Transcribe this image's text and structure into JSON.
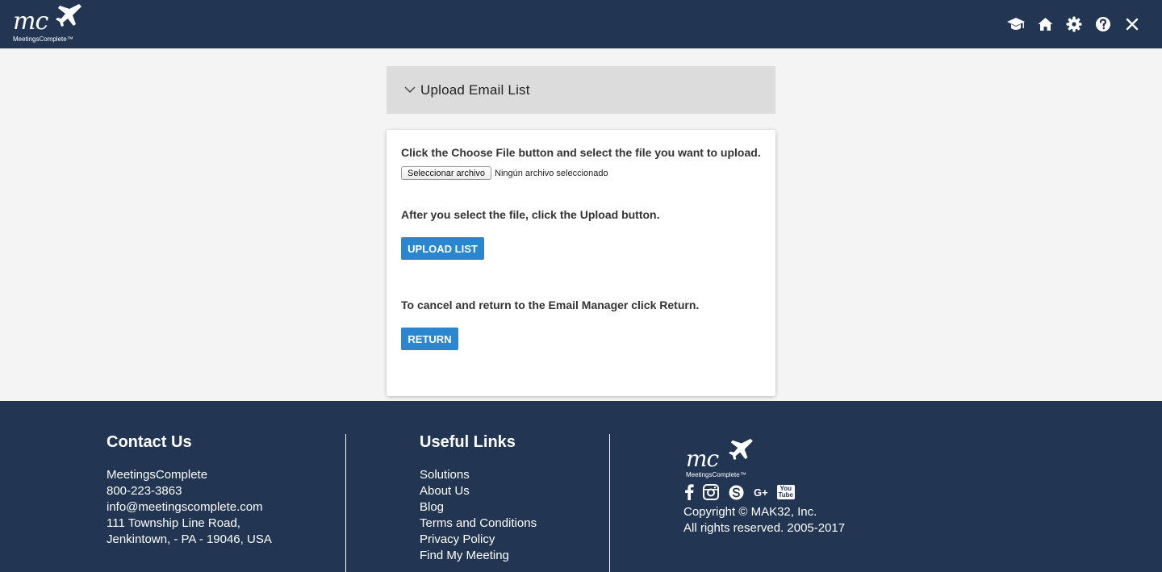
{
  "header": {
    "logo_text": "mc",
    "logo_sub": "MeetingsComplete™",
    "icons": [
      "graduation-cap-icon",
      "home-icon",
      "gear-icon",
      "help-icon",
      "close-icon"
    ]
  },
  "accordion": {
    "title": "Upload Email List"
  },
  "card": {
    "instruction_choose": "Click the Choose File button and select the file you want to upload.",
    "file_button_label": "Seleccionar archivo",
    "file_status": "Ningún archivo seleccionado",
    "instruction_upload": "After you select the file, click the Upload button.",
    "upload_button_label": "UPLOAD LIST",
    "instruction_return": "To cancel and return to the Email Manager click Return.",
    "return_button_label": "RETURN"
  },
  "footer": {
    "contact": {
      "heading": "Contact Us",
      "lines": [
        "MeetingsComplete",
        "800-223-3863",
        "info@meetingscomplete.com",
        "111 Township Line Road,",
        "Jenkintown, - PA - 19046, USA"
      ]
    },
    "links": {
      "heading": "Useful Links",
      "items": [
        "Solutions",
        "About Us",
        "Blog",
        "Terms and Conditions",
        "Privacy Policy",
        "Find My Meeting"
      ]
    },
    "brand": {
      "logo_text": "mc",
      "logo_sub": "MeetingsComplete™",
      "social": [
        "facebook-icon",
        "instagram-icon",
        "skype-icon",
        "google-plus-icon",
        "youtube-icon"
      ],
      "google_plus_text": "G+",
      "youtube_text": "You Tube",
      "copyright": "Copyright © MAK32, Inc.",
      "rights": "All rights reserved. 2005-2017"
    }
  },
  "colors": {
    "navy": "#223552",
    "button_blue": "#2a87cf",
    "accordion_gray": "#dcdcdc",
    "page_bg": "#f4f4f4"
  }
}
